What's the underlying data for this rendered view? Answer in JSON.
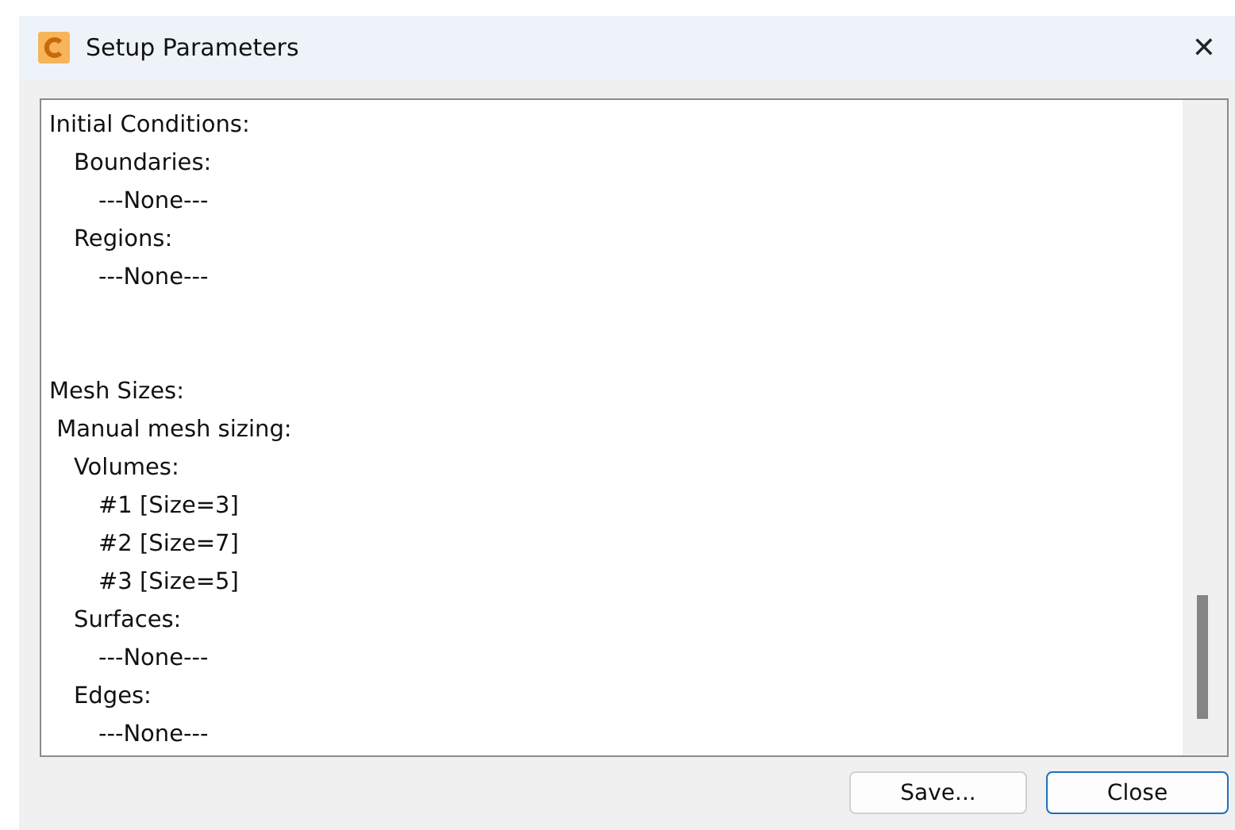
{
  "window": {
    "title": "Setup Parameters",
    "close_glyph": "✕"
  },
  "sections": [
    {
      "items": [
        {
          "text": "Initial Conditions:",
          "children": [
            {
              "text": "Boundaries:",
              "children": [
                {
                  "text": "---None---"
                }
              ]
            },
            {
              "text": "Regions:",
              "children": [
                {
                  "text": "---None---"
                }
              ]
            }
          ]
        }
      ]
    },
    {
      "items": [
        {
          "text": "Mesh Sizes:"
        },
        {
          "text": " Manual mesh sizing:",
          "children": [
            {
              "text": "Volumes:",
              "children": [
                {
                  "text": "#1 [Size=3]"
                },
                {
                  "text": "#2 [Size=7]"
                },
                {
                  "text": "#3 [Size=5]"
                }
              ]
            },
            {
              "text": "Surfaces:",
              "children": [
                {
                  "text": "---None---"
                }
              ]
            },
            {
              "text": "Edges:",
              "children": [
                {
                  "text": "---None---"
                }
              ]
            }
          ]
        }
      ]
    }
  ],
  "buttons": [
    {
      "label": "Save...",
      "selected": false
    },
    {
      "label": "Close",
      "selected": true
    }
  ]
}
